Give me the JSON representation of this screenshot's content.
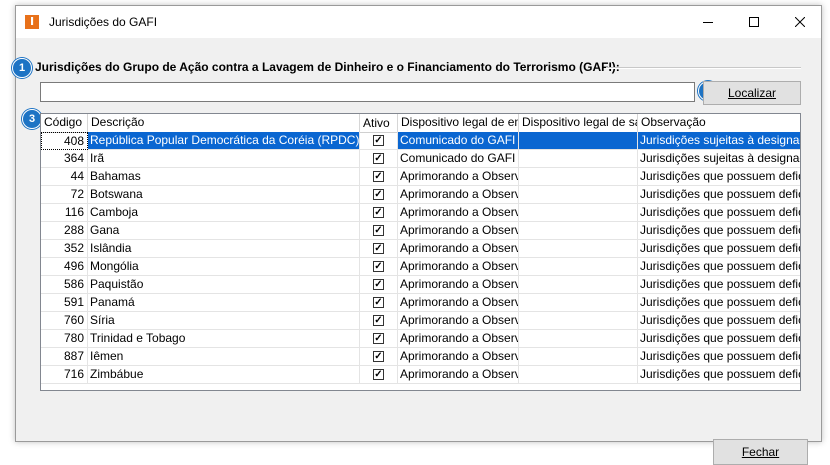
{
  "window": {
    "title": "Jurisdições do GAFI",
    "app_icon_letter": "I"
  },
  "badges": [
    "1",
    "2",
    "3"
  ],
  "group": {
    "label": "Jurisdições do Grupo de Ação contra a Lavagem de Dinheiro e o Financiamento do Terrorismo (GAFI):"
  },
  "search": {
    "value": "",
    "button_label": "Localizar"
  },
  "table": {
    "columns": [
      "Código",
      "Descrição",
      "Ativo",
      "Dispositivo legal de entr",
      "Dispositivo legal de saíd",
      "Observação"
    ],
    "rows": [
      {
        "code": "408",
        "desc": "República Popular Democrática da Coréia (RPDC)",
        "ativo": true,
        "disp_entrada": "Comunicado do GAFI de",
        "disp_saida": "",
        "obs": "Jurisdições sujeitas à designação",
        "selected": true
      },
      {
        "code": "364",
        "desc": "Irã",
        "ativo": true,
        "disp_entrada": "Comunicado do GAFI de",
        "disp_saida": "",
        "obs": "Jurisdições sujeitas à designação"
      },
      {
        "code": "44",
        "desc": "Bahamas",
        "ativo": true,
        "disp_entrada": "Aprimorando a Observâ",
        "disp_saida": "",
        "obs": "Jurisdições que possuem deficiên"
      },
      {
        "code": "72",
        "desc": "Botswana",
        "ativo": true,
        "disp_entrada": "Aprimorando a Observâ",
        "disp_saida": "",
        "obs": "Jurisdições que possuem deficiên"
      },
      {
        "code": "116",
        "desc": "Camboja",
        "ativo": true,
        "disp_entrada": "Aprimorando a Observâ",
        "disp_saida": "",
        "obs": "Jurisdições que possuem deficiên"
      },
      {
        "code": "288",
        "desc": "Gana",
        "ativo": true,
        "disp_entrada": "Aprimorando a Observâ",
        "disp_saida": "",
        "obs": "Jurisdições que possuem deficiên"
      },
      {
        "code": "352",
        "desc": "Islândia",
        "ativo": true,
        "disp_entrada": "Aprimorando a Observâ",
        "disp_saida": "",
        "obs": "Jurisdições que possuem deficiên"
      },
      {
        "code": "496",
        "desc": "Mongólia",
        "ativo": true,
        "disp_entrada": "Aprimorando a Observâ",
        "disp_saida": "",
        "obs": "Jurisdições que possuem deficiên"
      },
      {
        "code": "586",
        "desc": "Paquistão",
        "ativo": true,
        "disp_entrada": "Aprimorando a Observâ",
        "disp_saida": "",
        "obs": "Jurisdições que possuem deficiên"
      },
      {
        "code": "591",
        "desc": "Panamá",
        "ativo": true,
        "disp_entrada": "Aprimorando a Observâ",
        "disp_saida": "",
        "obs": "Jurisdições que possuem deficiên"
      },
      {
        "code": "760",
        "desc": "Síria",
        "ativo": true,
        "disp_entrada": "Aprimorando a Observâ",
        "disp_saida": "",
        "obs": "Jurisdições que possuem deficiên"
      },
      {
        "code": "780",
        "desc": "Trinidad e Tobago",
        "ativo": true,
        "disp_entrada": "Aprimorando a Observâ",
        "disp_saida": "",
        "obs": "Jurisdições que possuem deficiên"
      },
      {
        "code": "887",
        "desc": "Iêmen",
        "ativo": true,
        "disp_entrada": "Aprimorando a Observâ",
        "disp_saida": "",
        "obs": "Jurisdições que possuem deficiên"
      },
      {
        "code": "716",
        "desc": "Zimbábue",
        "ativo": true,
        "disp_entrada": "Aprimorando a Observâ",
        "disp_saida": "",
        "obs": "Jurisdições que possuem deficiên"
      }
    ]
  },
  "footer": {
    "close_button_label": "Fechar"
  },
  "colors": {
    "accent": "#1d73c4",
    "selection": "#0a66d1",
    "app_icon": "#e8711a"
  },
  "icons": {
    "minimize": "minimize-icon",
    "maximize": "maximize-icon",
    "close": "close-icon",
    "check": "checkbox-checked-icon"
  }
}
